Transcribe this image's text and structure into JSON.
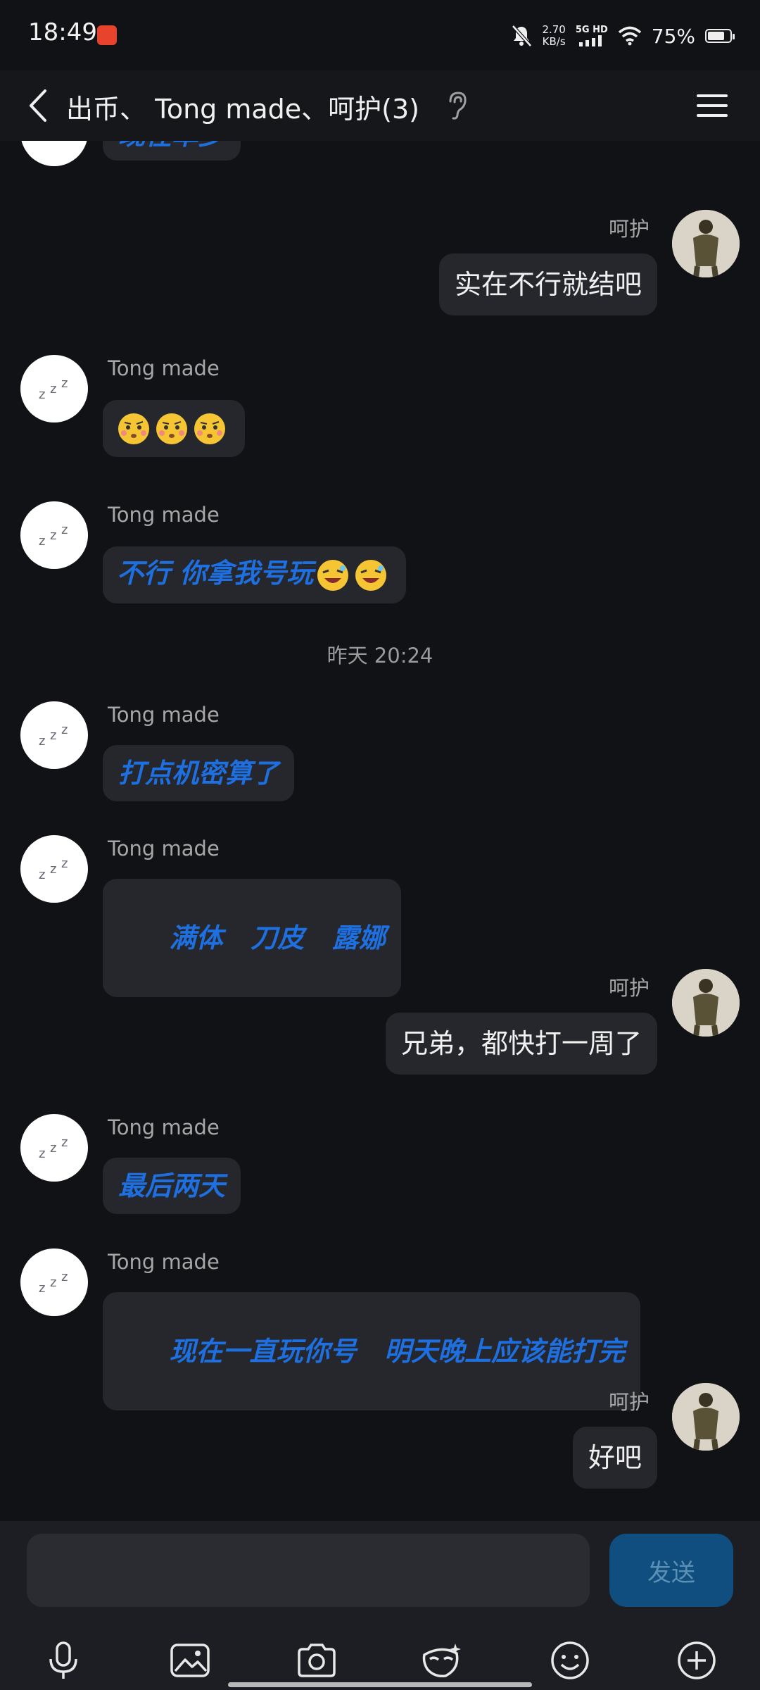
{
  "status_bar": {
    "time": "18:49",
    "net_speed_value": "2.70",
    "net_speed_unit": "KB/s",
    "network_type": "5G HD",
    "battery_percent": "75%",
    "battery_level": 0.75
  },
  "header": {
    "title": "出币、 Tong made、呵护(3)"
  },
  "chat": {
    "partial_top_message": "现在单少",
    "timestamp": "昨天 20:24",
    "messages": [
      {
        "sender": "呵护",
        "text": "实在不行就结吧"
      },
      {
        "sender": "Tong made",
        "text": "",
        "emoji": [
          "eyebrow-raised-emoji",
          "eyebrow-raised-emoji",
          "eyebrow-raised-emoji"
        ]
      },
      {
        "sender": "Tong made",
        "text": "不行 你拿我号玩",
        "emoji": [
          "laughing-emoji",
          "laughing-emoji"
        ]
      },
      {
        "sender": "Tong made",
        "text": "打点机密算了"
      },
      {
        "sender": "Tong made",
        "text": "满体   刀皮   露娜"
      },
      {
        "sender": "呵护",
        "text": "兄弟，都快打一周了"
      },
      {
        "sender": "Tong made",
        "text": "最后两天"
      },
      {
        "sender": "Tong made",
        "text": "现在一直玩你号   明天晚上应该能打完"
      },
      {
        "sender": "呵护",
        "text": "好吧"
      }
    ]
  },
  "input": {
    "placeholder": "",
    "send_label": "发送"
  },
  "toolbar": {
    "icons": [
      "microphone-icon",
      "image-icon",
      "camera-icon",
      "mask-icon",
      "emoji-icon",
      "plus-icon"
    ]
  },
  "colors": {
    "background": "#111216",
    "bubble": "#26272c",
    "styled_text": "#1e6fe0",
    "send_button": "#0f4e7e"
  }
}
